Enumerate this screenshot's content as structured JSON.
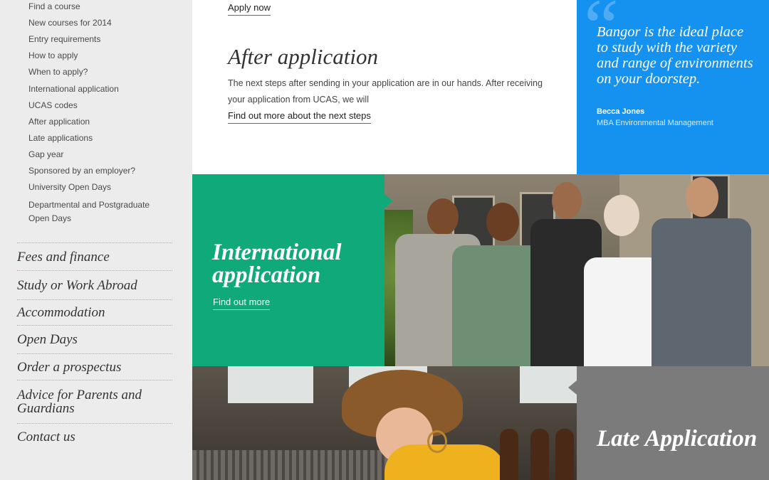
{
  "sidebar": {
    "sub_items": [
      "Find a course",
      "New courses for 2014",
      "Entry requirements",
      "How to apply",
      "When to apply?",
      "International application",
      "UCAS codes",
      "After application",
      "Late applications",
      "Gap year",
      "Sponsored by an employer?",
      "University Open Days",
      "Departmental and Postgraduate Open Days"
    ],
    "main_items": [
      "Fees and finance",
      "Study or Work Abroad",
      "Accommodation",
      "Open Days",
      "Order a prospectus",
      "Advice for Parents and Guardians",
      "Contact us"
    ]
  },
  "content": {
    "apply_now": "Apply now",
    "heading": "After application",
    "paragraph": "The next steps after sending in your application are in our hands. After receiving your application from UCAS, we will",
    "next_steps_link": "Find out more about the next steps"
  },
  "quote": {
    "text": "Bangor is the ideal place to study with the variety and range of environments on your doorstep.",
    "author": "Becca Jones",
    "role": "MBA Environmental Management"
  },
  "tiles": {
    "international_title": "International application",
    "international_link": "Find out more",
    "late_title": "Late Application"
  },
  "colors": {
    "quote_bg": "#1591f0",
    "international_bg": "#10a97a",
    "late_bg": "#7b7b7b",
    "sidebar_bg": "#ececec",
    "link_underline": "#d13a4b"
  }
}
